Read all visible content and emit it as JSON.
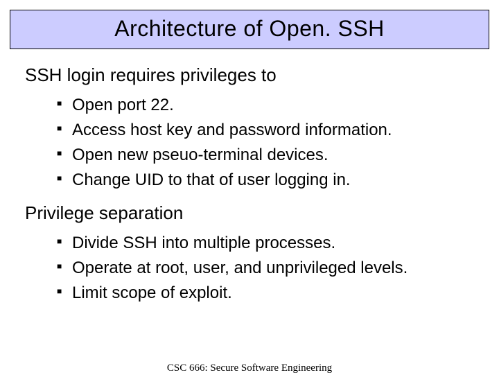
{
  "title": "Architecture of Open. SSH",
  "sections": [
    {
      "heading": "SSH login requires privileges to",
      "items": [
        "Open port 22.",
        "Access host key and password information.",
        "Open new pseuo-terminal devices.",
        "Change UID to that of user logging in."
      ]
    },
    {
      "heading": "Privilege separation",
      "items": [
        "Divide SSH into multiple processes.",
        "Operate at root, user, and unprivileged levels.",
        "Limit scope of exploit."
      ]
    }
  ],
  "footer": "CSC 666: Secure Software Engineering"
}
